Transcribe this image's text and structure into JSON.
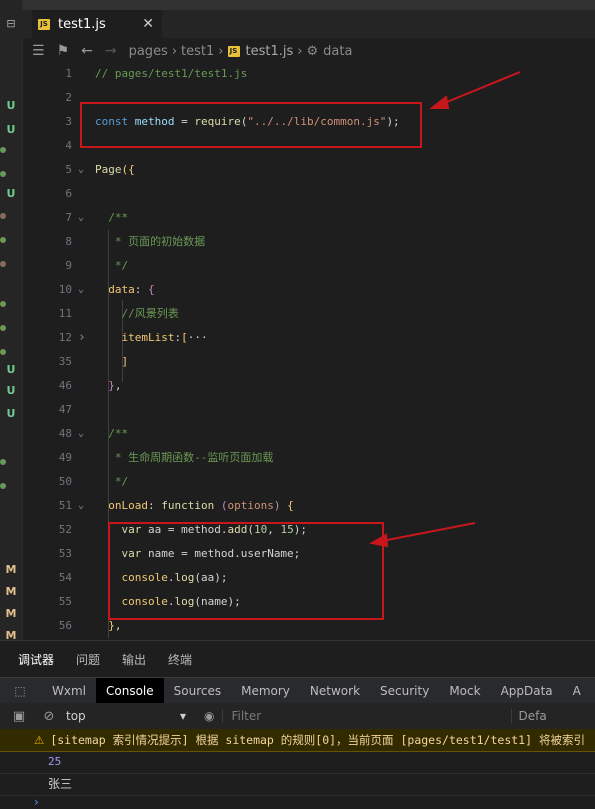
{
  "tab": {
    "label": "test1.js",
    "close": "✕",
    "icon": "js-file-icon",
    "badge": "JS"
  },
  "breadcrumb": [
    "pages",
    "test1",
    "test1.js",
    "data"
  ],
  "colors": {
    "annotation": "#c8161d",
    "console_bg": "#000000",
    "warning_bg": "#332b00"
  },
  "code_lines": [
    {
      "n": "1",
      "tokens": [
        [
          "c-com",
          "// pages/test1/test1.js"
        ]
      ]
    },
    {
      "n": "2",
      "tokens": []
    },
    {
      "n": "3",
      "tokens": [
        [
          "c-kw",
          "const "
        ],
        [
          "c-var",
          "method"
        ],
        [
          "c-op",
          " = "
        ],
        [
          "c-fn",
          "require"
        ],
        [
          "c-op",
          "("
        ],
        [
          "c-str",
          "\"../../lib/common.js\""
        ],
        [
          "c-op",
          ");"
        ]
      ]
    },
    {
      "n": "4",
      "tokens": []
    },
    {
      "n": "5",
      "tokens": [
        [
          "c-fn",
          "Page"
        ],
        [
          "c-warm",
          "({"
        ]
      ],
      "fold": "open"
    },
    {
      "n": "6",
      "tokens": []
    },
    {
      "n": "7",
      "tokens": [
        [
          "c-com",
          "  /**"
        ]
      ],
      "fold": "open"
    },
    {
      "n": "8",
      "tokens": [
        [
          "c-com",
          "   * 页面的初始数据"
        ]
      ]
    },
    {
      "n": "9",
      "tokens": [
        [
          "c-com",
          "   */"
        ]
      ]
    },
    {
      "n": "10",
      "tokens": [
        [
          "c-key",
          "  data"
        ],
        [
          "c-op",
          ": "
        ],
        [
          "c-pink",
          "{"
        ]
      ],
      "fold": "open"
    },
    {
      "n": "11",
      "tokens": [
        [
          "c-com",
          "    //风景列表"
        ]
      ]
    },
    {
      "n": "12",
      "tokens": [
        [
          "c-key",
          "    itemList"
        ],
        [
          "c-op",
          ":"
        ],
        [
          "c-warm",
          "["
        ],
        [
          "c-plain",
          "···"
        ]
      ],
      "fold": "closed"
    },
    {
      "n": "35",
      "tokens": [
        [
          "c-warm",
          "    ]"
        ]
      ]
    },
    {
      "n": "46",
      "tokens": [
        [
          "c-pink",
          "  }"
        ],
        [
          "c-op",
          ","
        ]
      ]
    },
    {
      "n": "47",
      "tokens": []
    },
    {
      "n": "48",
      "tokens": [
        [
          "c-com",
          "  /**"
        ]
      ],
      "fold": "open"
    },
    {
      "n": "49",
      "tokens": [
        [
          "c-com",
          "   * 生命周期函数--监听页面加载"
        ]
      ]
    },
    {
      "n": "50",
      "tokens": [
        [
          "c-com",
          "   */"
        ]
      ]
    },
    {
      "n": "51",
      "tokens": [
        [
          "c-key",
          "  onLoad"
        ],
        [
          "c-op",
          ": "
        ],
        [
          "c-fn",
          "function "
        ],
        [
          "c-pink",
          "("
        ],
        [
          "c-str",
          "options"
        ],
        [
          "c-pink",
          ") "
        ],
        [
          "c-warm",
          "{"
        ]
      ],
      "fold": "open"
    },
    {
      "n": "52",
      "tokens": [
        [
          "c-fn",
          "    var "
        ],
        [
          "c-plain",
          "aa = method."
        ],
        [
          "c-fn",
          "add"
        ],
        [
          "c-op",
          "("
        ],
        [
          "c-num",
          "10"
        ],
        [
          "c-op",
          ", "
        ],
        [
          "c-num",
          "15"
        ],
        [
          "c-op",
          ");"
        ]
      ]
    },
    {
      "n": "53",
      "tokens": [
        [
          "c-fn",
          "    var "
        ],
        [
          "c-plain",
          "name = method.userName;"
        ]
      ]
    },
    {
      "n": "54",
      "tokens": [
        [
          "c-plain",
          "    "
        ],
        [
          "c-key",
          "console"
        ],
        [
          "c-op",
          "."
        ],
        [
          "c-fn",
          "log"
        ],
        [
          "c-op",
          "(aa);"
        ]
      ]
    },
    {
      "n": "55",
      "tokens": [
        [
          "c-plain",
          "    "
        ],
        [
          "c-key",
          "console"
        ],
        [
          "c-op",
          "."
        ],
        [
          "c-fn",
          "log"
        ],
        [
          "c-op",
          "(name);"
        ]
      ]
    },
    {
      "n": "56",
      "tokens": [
        [
          "c-warm",
          "  }"
        ],
        [
          "c-op",
          ","
        ]
      ]
    }
  ],
  "panel_tabs": [
    "调试器",
    "问题",
    "输出",
    "终端"
  ],
  "devtools_tabs": [
    "Wxml",
    "Console",
    "Sources",
    "Memory",
    "Network",
    "Security",
    "Mock",
    "AppData",
    "A"
  ],
  "console_toolbar": {
    "context": "top",
    "filter_placeholder": "Filter",
    "levels": "Defa"
  },
  "console_warning": "[sitemap 索引情况提示] 根据 sitemap 的规则[0]，当前页面 [pages/test1/test1] 将被索引",
  "console_output": [
    "25",
    "张三"
  ],
  "gutter_marks": [
    "U",
    "U",
    "U",
    "U",
    "U",
    "U",
    "M",
    "M",
    "M",
    "M"
  ]
}
